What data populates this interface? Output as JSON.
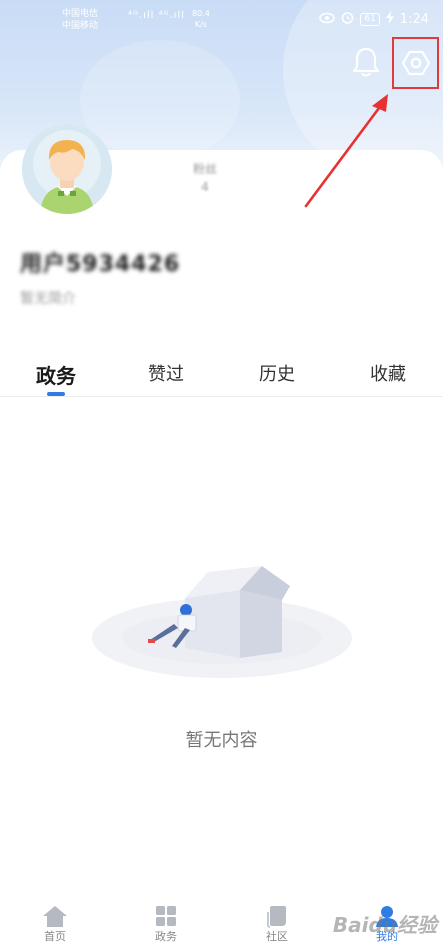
{
  "status_bar": {
    "carrier_1": "中国电信",
    "carrier_2": "中国移动",
    "signal": "⁴ᴳ.ıll ⁴ᴳ.ıll",
    "net_speed_value": "80.4",
    "net_speed_unit": "K/s",
    "battery": "61",
    "time": "1:24"
  },
  "profile": {
    "username": "用户5934426",
    "bio": "暂无简介",
    "stat_label": "粉丝",
    "stat_value": "4"
  },
  "tabs": [
    {
      "label": "政务",
      "active": true
    },
    {
      "label": "赞过",
      "active": false
    },
    {
      "label": "历史",
      "active": false
    },
    {
      "label": "收藏",
      "active": false
    }
  ],
  "empty_state": {
    "message": "暂无内容"
  },
  "bottom_nav": [
    {
      "label": "首页",
      "icon": "home-icon",
      "active": false
    },
    {
      "label": "政务",
      "icon": "grid-icon",
      "active": false
    },
    {
      "label": "社区",
      "icon": "community-icon",
      "active": false
    },
    {
      "label": "我的",
      "icon": "me-icon",
      "active": true
    }
  ],
  "watermark": "Baidu经验",
  "colors": {
    "accent": "#2f7de1",
    "highlight": "#e03a3a",
    "header_gradient_top": "#c9dcf6"
  }
}
